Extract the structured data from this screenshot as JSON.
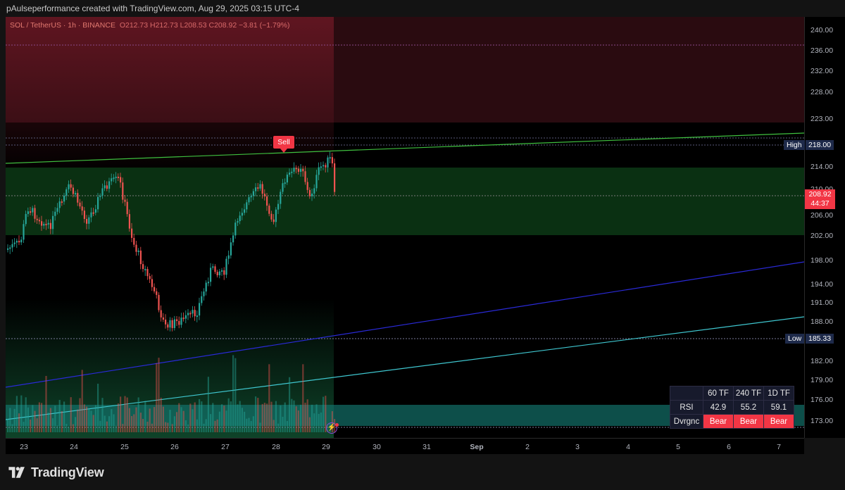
{
  "header": {
    "text": "pAulseperformance created with TradingView.com, Aug 29, 2025 03:15 UTC-4"
  },
  "symbol": {
    "name": "SOL / TetherUS · 1h · BINANCE",
    "ohlc": "O212.73  H212.73  L208.53  C208.92  −3.81 (−1.79%)"
  },
  "price_axis": {
    "ticks": [
      "240.00",
      "236.00",
      "232.00",
      "228.00",
      "223.00",
      "214.00",
      "210.00",
      "206.00",
      "202.00",
      "198.00",
      "194.00",
      "191.00",
      "188.00",
      "182.00",
      "179.00",
      "176.00",
      "173.00"
    ],
    "high_label": "High",
    "high_value": "218.00",
    "low_label": "Low",
    "low_value": "185.33",
    "current_price": "208.92",
    "countdown": "44:37"
  },
  "time_axis": {
    "labels": [
      "23",
      "24",
      "25",
      "26",
      "27",
      "28",
      "29",
      "30",
      "31",
      "Sep",
      "2",
      "3",
      "4",
      "5",
      "6",
      "7"
    ]
  },
  "signal": {
    "label": "Sell"
  },
  "rsi_table": {
    "headers": [
      "60 TF",
      "240 TF",
      "1D TF"
    ],
    "rsi_label": "RSI",
    "rsi_values": [
      "42.9",
      "55.2",
      "59.1"
    ],
    "div_label": "Dvrgnc",
    "div_values": [
      "Bear",
      "Bear",
      "Bear"
    ]
  },
  "footer": {
    "brand": "TradingView"
  },
  "colors": {
    "up": "#26a69a",
    "down": "#ef5350",
    "sell": "#f23645",
    "resistance": "#5d1620",
    "support": "#0c3d12"
  },
  "icons": {
    "logo": "tradingview-logo-icon",
    "replay": "lightning-icon"
  }
}
